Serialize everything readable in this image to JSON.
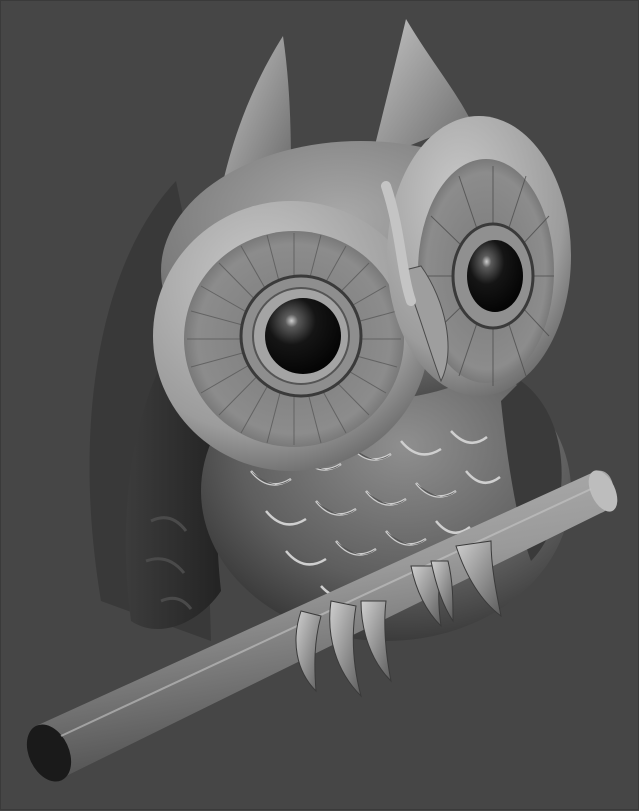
{
  "scene": {
    "subject": "owl-on-branch-render",
    "colors": {
      "background": "#464646",
      "model_light": "#bdbdbd",
      "model_mid": "#8a8a8a",
      "model_dark": "#2e2e2e",
      "eye_pupil": "#0c0c0c"
    }
  }
}
